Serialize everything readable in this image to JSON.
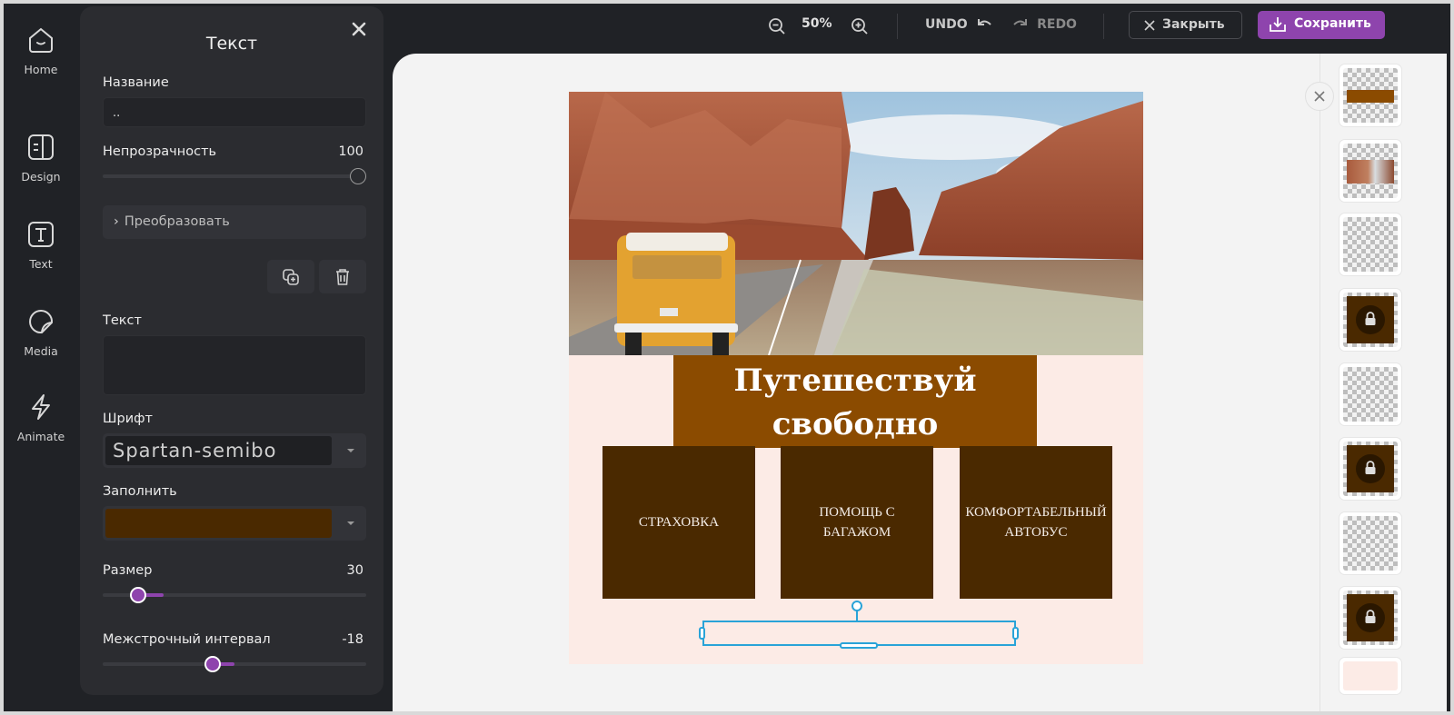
{
  "rail": {
    "items": [
      {
        "label": "Home",
        "icon": "home-icon"
      },
      {
        "label": "Design",
        "icon": "design-icon"
      },
      {
        "label": "Text",
        "icon": "text-icon"
      },
      {
        "label": "Media",
        "icon": "media-icon"
      },
      {
        "label": "Animate",
        "icon": "animate-icon"
      }
    ]
  },
  "panel": {
    "title": "Текст",
    "name_label": "Название",
    "name_value": "..",
    "opacity_label": "Непрозрачность",
    "opacity_value": "100",
    "opacity_fraction": 1.0,
    "transform_label": "Преобразовать",
    "duplicate_icon": "duplicate-icon",
    "delete_icon": "trash-icon",
    "text_label": "Текст",
    "text_value": "",
    "font_label": "Шрифт",
    "font_value": "Spartan-semibo",
    "fill_label": "Заполнить",
    "fill_color": "#4a2900",
    "size_label": "Размер",
    "size_value": "30",
    "line_spacing_label": "Межстрочный интервал",
    "line_spacing_value": "-18"
  },
  "toolbar": {
    "zoom_value": "50%",
    "undo_label": "UNDO",
    "redo_label": "REDO",
    "close_label": "Закрыть",
    "save_label": "Сохранить",
    "accent_color": "#8e44ad"
  },
  "design": {
    "background_color": "#fcebe6",
    "title_line1": "Путешествуй",
    "title_line2": "свободно",
    "title_bg_color": "#8b4b00",
    "feature_bg_color": "#4a2900",
    "features": [
      {
        "text": "СТРАХОВКА"
      },
      {
        "text": "ПОМОЩЬ С\nБАГАЖОМ"
      },
      {
        "text": "КОМФОРТАБЕЛЬНЫЙ\nАВТОБУС"
      }
    ],
    "selection_color": "#29a3d8"
  },
  "layers": {
    "items": [
      {
        "type": "title-text",
        "locked": false
      },
      {
        "type": "photo",
        "locked": false
      },
      {
        "type": "text",
        "locked": false
      },
      {
        "type": "box",
        "locked": true
      },
      {
        "type": "text",
        "locked": false
      },
      {
        "type": "box",
        "locked": true
      },
      {
        "type": "text",
        "locked": false
      },
      {
        "type": "box",
        "locked": true
      },
      {
        "type": "background",
        "locked": false
      }
    ]
  }
}
